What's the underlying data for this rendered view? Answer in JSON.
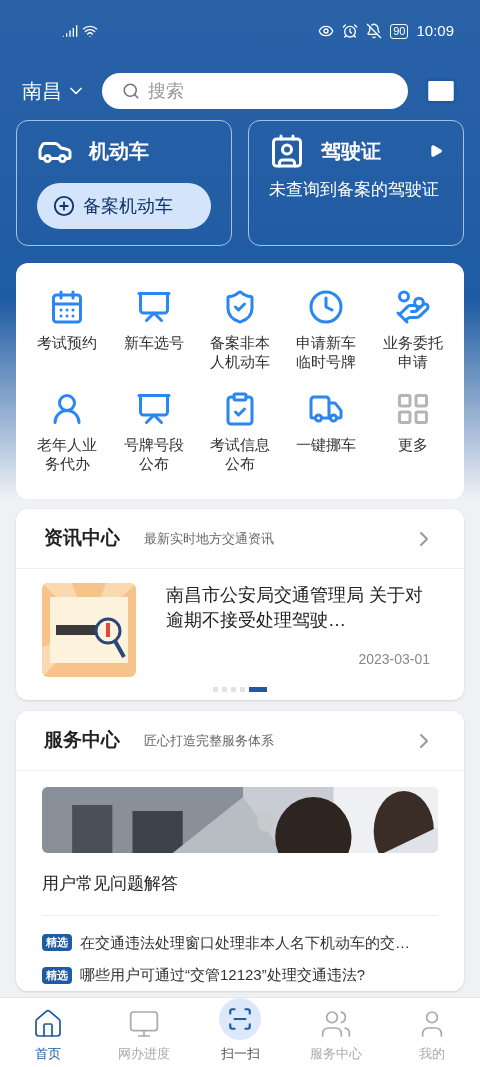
{
  "status_bar": {
    "time": "10:09",
    "battery": "90"
  },
  "header": {
    "city": "南昌",
    "search": {
      "placeholder": "搜索"
    }
  },
  "vehicle_card": {
    "title": "机动车",
    "button": "备案机动车"
  },
  "license_card": {
    "title": "驾驶证",
    "message": "未查询到备案的驾驶证"
  },
  "services": [
    {
      "label": "考试预约"
    },
    {
      "label": "新车选号"
    },
    {
      "label": "备案非本人机动车"
    },
    {
      "label": "申请新车临时号牌"
    },
    {
      "label": "业务委托申请"
    },
    {
      "label": "老年人业务代办"
    },
    {
      "label": "号牌号段公布"
    },
    {
      "label": "考试信息公布"
    },
    {
      "label": "一键挪车"
    },
    {
      "label": "更多"
    }
  ],
  "news": {
    "title": "资讯中心",
    "subtitle": "最新实时地方交通资讯",
    "headline": "南昌市公安局交通管理局 关于对逾期不接受处理驾驶…",
    "date": "2023-03-01",
    "dots": [
      {
        "selected": false
      },
      {
        "selected": false
      },
      {
        "selected": false
      },
      {
        "selected": false
      },
      {
        "selected": true
      }
    ]
  },
  "service_center": {
    "title": "服务中心",
    "subtitle": "匠心打造完整服务体系",
    "faq_title": "用户常见问题解答",
    "questions": [
      {
        "tag": "精选",
        "text": "在交通违法处理窗口处理非本人名下机动车的交…"
      },
      {
        "tag": "精选",
        "text": "哪些用户可通过“交管12123”处理交通违法?"
      }
    ]
  },
  "tab_bar": [
    {
      "label": "首页",
      "selected": true
    },
    {
      "label": "网办进度",
      "selected": false
    },
    {
      "label": "扫一扫",
      "selected": false
    },
    {
      "label": "服务中心",
      "selected": false
    },
    {
      "label": "我的",
      "selected": false
    }
  ]
}
